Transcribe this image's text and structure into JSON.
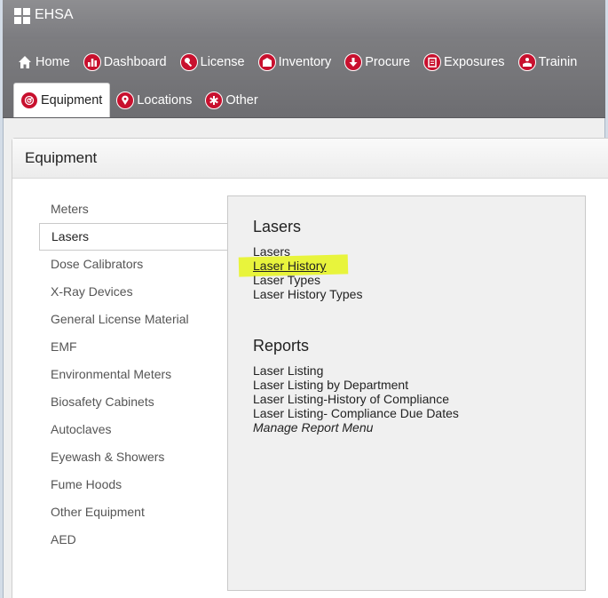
{
  "app": {
    "title": "EHSA"
  },
  "nav": {
    "row1": [
      {
        "label": "Home",
        "icon": "home-icon"
      },
      {
        "label": "Dashboard",
        "icon": "dashboard-icon"
      },
      {
        "label": "License",
        "icon": "license-icon"
      },
      {
        "label": "Inventory",
        "icon": "inventory-icon"
      },
      {
        "label": "Procure",
        "icon": "procure-icon"
      },
      {
        "label": "Exposures",
        "icon": "exposures-icon"
      },
      {
        "label": "Trainin",
        "icon": "training-icon"
      }
    ],
    "row2": [
      {
        "label": "Equipment",
        "icon": "equipment-icon",
        "active": true
      },
      {
        "label": "Locations",
        "icon": "locations-icon"
      },
      {
        "label": "Other",
        "icon": "other-icon"
      }
    ]
  },
  "panel": {
    "title": "Equipment"
  },
  "sidebar": {
    "items": [
      {
        "label": "Meters"
      },
      {
        "label": "Lasers",
        "active": true
      },
      {
        "label": "Dose Calibrators"
      },
      {
        "label": "X-Ray Devices"
      },
      {
        "label": "General License Material"
      },
      {
        "label": "EMF"
      },
      {
        "label": "Environmental Meters"
      },
      {
        "label": "Biosafety Cabinets"
      },
      {
        "label": "Autoclaves"
      },
      {
        "label": "Eyewash & Showers"
      },
      {
        "label": "Fume Hoods"
      },
      {
        "label": "Other Equipment"
      },
      {
        "label": "AED"
      }
    ]
  },
  "content": {
    "lasers_title": "Lasers",
    "lasers_links": [
      "Lasers",
      "Laser History",
      "Laser Types",
      "Laser History Types"
    ],
    "reports_title": "Reports",
    "reports_links": [
      "Laser Listing",
      "Laser Listing by Department",
      "Laser Listing-History of Compliance",
      "Laser Listing- Compliance Due Dates",
      "Manage Report Menu"
    ]
  },
  "colors": {
    "accent": "#c8102e",
    "highlight": "#e8f43c",
    "navbar": "#7a7a7e"
  }
}
